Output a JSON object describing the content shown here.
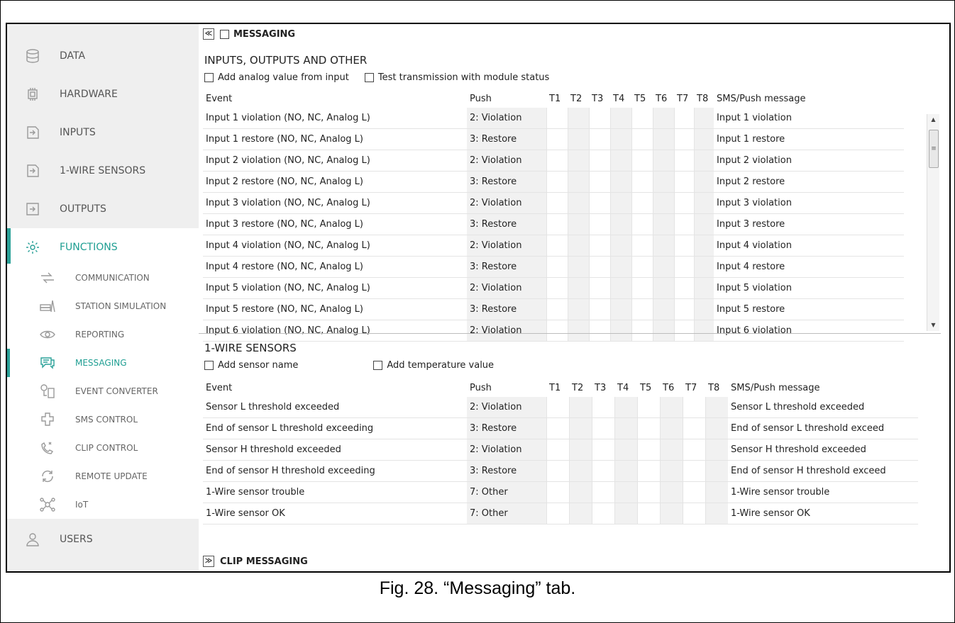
{
  "sidebar": {
    "main_top": [
      {
        "label": "DATA",
        "icon": "database-icon"
      },
      {
        "label": "HARDWARE",
        "icon": "chip-icon"
      },
      {
        "label": "INPUTS",
        "icon": "input-icon"
      },
      {
        "label": "1-WIRE SENSORS",
        "icon": "input-icon"
      },
      {
        "label": "OUTPUTS",
        "icon": "output-icon"
      },
      {
        "label": "FUNCTIONS",
        "icon": "gear-icon"
      }
    ],
    "sub": [
      {
        "label": "COMMUNICATION",
        "icon": "arrows-icon"
      },
      {
        "label": "STATION SIMULATION",
        "icon": "station-icon"
      },
      {
        "label": "REPORTING",
        "icon": "eye-icon"
      },
      {
        "label": "MESSAGING",
        "icon": "chat-icon"
      },
      {
        "label": "EVENT CONVERTER",
        "icon": "converter-icon"
      },
      {
        "label": "SMS CONTROL",
        "icon": "sms-icon"
      },
      {
        "label": "CLIP CONTROL",
        "icon": "phone-icon"
      },
      {
        "label": "REMOTE UPDATE",
        "icon": "refresh-icon"
      },
      {
        "label": "IoT",
        "icon": "network-icon"
      }
    ],
    "users": {
      "label": "USERS",
      "icon": "user-icon"
    },
    "active_main": "FUNCTIONS",
    "active_sub": "MESSAGING",
    "accent_color": "#2aa198"
  },
  "messaging": {
    "collapse_glyph": "≪",
    "title": "MESSAGING",
    "inputs_section": {
      "title": "INPUTS, OUTPUTS AND OTHER",
      "option_1": "Add analog value from input",
      "option_2": "Test transmission with module status",
      "headers": {
        "event": "Event",
        "push": "Push",
        "t1": "T1",
        "t2": "T2",
        "t3": "T3",
        "t4": "T4",
        "t5": "T5",
        "t6": "T6",
        "t7": "T7",
        "t8": "T8",
        "message": "SMS/Push message"
      },
      "rows": [
        {
          "event": "Input 1 violation (NO, NC, Analog L)",
          "push": "2: Violation",
          "message": "Input 1 violation"
        },
        {
          "event": "Input 1 restore (NO, NC, Analog L)",
          "push": "3: Restore",
          "message": "Input 1 restore"
        },
        {
          "event": "Input 2 violation (NO, NC, Analog L)",
          "push": "2: Violation",
          "message": "Input 2 violation"
        },
        {
          "event": "Input 2 restore (NO, NC, Analog L)",
          "push": "3: Restore",
          "message": "Input 2 restore"
        },
        {
          "event": "Input 3 violation (NO, NC, Analog L)",
          "push": "2: Violation",
          "message": "Input 3 violation"
        },
        {
          "event": "Input 3 restore (NO, NC, Analog L)",
          "push": "3: Restore",
          "message": "Input 3 restore"
        },
        {
          "event": "Input 4 violation (NO, NC, Analog L)",
          "push": "2: Violation",
          "message": "Input 4 violation"
        },
        {
          "event": "Input 4 restore (NO, NC, Analog L)",
          "push": "3: Restore",
          "message": "Input 4 restore"
        },
        {
          "event": "Input 5 violation (NO, NC, Analog L)",
          "push": "2: Violation",
          "message": "Input 5 violation"
        },
        {
          "event": "Input 5 restore (NO, NC, Analog L)",
          "push": "3: Restore",
          "message": "Input 5 restore"
        },
        {
          "event": "Input 6 violation (NO, NC, Analog L)",
          "push": "2: Violation",
          "message": "Input 6 violation"
        }
      ]
    },
    "wire_section": {
      "title": "1-WIRE SENSORS",
      "option_1": "Add sensor name",
      "option_2": "Add temperature value",
      "headers": {
        "event": "Event",
        "push": "Push",
        "t1": "T1",
        "t2": "T2",
        "t3": "T3",
        "t4": "T4",
        "t5": "T5",
        "t6": "T6",
        "t7": "T7",
        "t8": "T8",
        "message": "SMS/Push message"
      },
      "rows": [
        {
          "event": "Sensor L threshold exceeded",
          "push": "2: Violation",
          "message": "Sensor L threshold exceeded"
        },
        {
          "event": "End of sensor L threshold exceeding",
          "push": "3: Restore",
          "message": "End of sensor L threshold exceed"
        },
        {
          "event": "Sensor H threshold exceeded",
          "push": "2: Violation",
          "message": "Sensor H threshold exceeded"
        },
        {
          "event": "End of sensor H threshold exceeding",
          "push": "3: Restore",
          "message": "End of sensor H threshold exceed"
        },
        {
          "event": "1-Wire sensor trouble",
          "push": "7: Other",
          "message": "1-Wire sensor trouble"
        },
        {
          "event": "1-Wire sensor OK",
          "push": "7: Other",
          "message": "1-Wire sensor OK"
        }
      ]
    }
  },
  "clip": {
    "expand_glyph": "≫",
    "title": "CLIP MESSAGING"
  },
  "caption": "Fig. 28. “Messaging” tab."
}
